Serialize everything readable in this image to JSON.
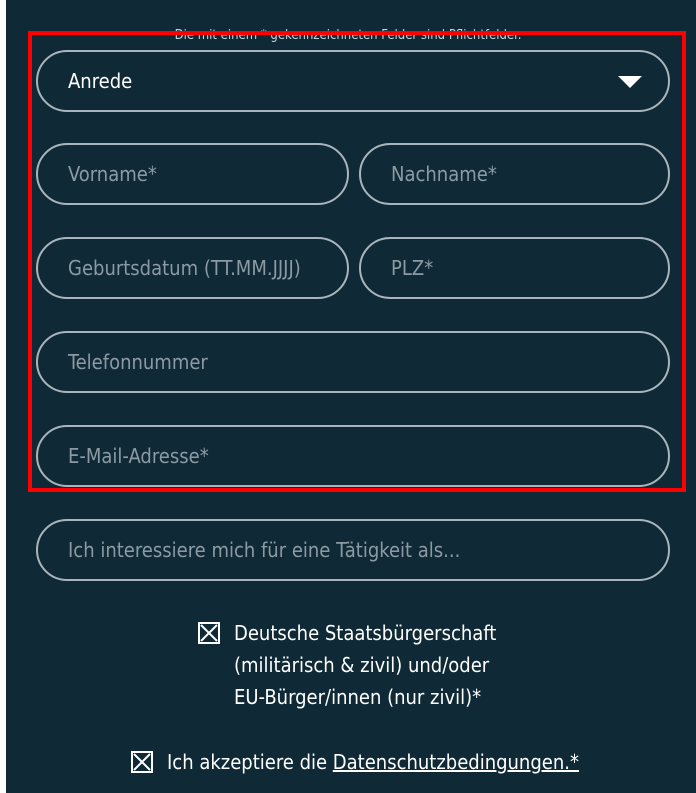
{
  "form": {
    "notice": "Die mit einem * gekennzeichneten Felder sind Pflichtfelder.",
    "salutation": {
      "value": "Anrede"
    },
    "firstname": {
      "placeholder": "Vorname*"
    },
    "lastname": {
      "placeholder": "Nachname*"
    },
    "birthdate": {
      "placeholder": "Geburtsdatum (TT.MM.JJJJ)"
    },
    "zip": {
      "placeholder": "PLZ*"
    },
    "phone": {
      "placeholder": "Telefonnummer"
    },
    "email": {
      "placeholder": "E-Mail-Adresse*"
    },
    "interest": {
      "placeholder": "Ich interessiere mich für eine Tätigkeit als..."
    }
  },
  "checkboxes": {
    "citizenship": {
      "checked": true,
      "lines": [
        "Deutsche Staatsbürgerschaft",
        "(militärisch & zivil) und/oder",
        "EU-Bürger/innen (nur zivil)*"
      ]
    },
    "privacy": {
      "checked": true,
      "text": "Ich akzeptiere die ",
      "link": "Datenschutzbedingungen.*"
    }
  },
  "colors": {
    "background": "#0f2a36",
    "field_border": "#a9b5bc",
    "placeholder": "#8c9ba3",
    "highlight": "#ff0000"
  },
  "icons": {
    "select_caret": "caret-down-icon",
    "checkbox_checked": "x-mark-icon"
  }
}
